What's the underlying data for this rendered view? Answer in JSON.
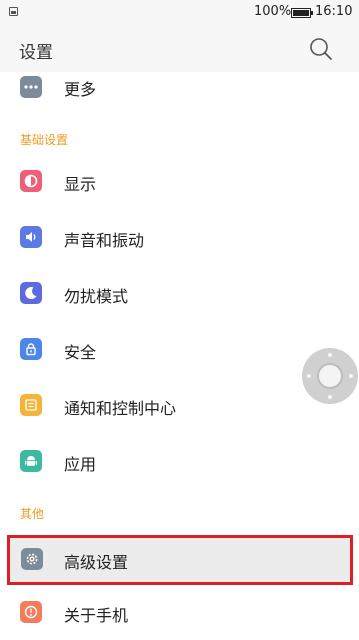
{
  "status_bar": {
    "battery": "100%",
    "time": "16:10"
  },
  "header": {
    "title": "设置"
  },
  "items": {
    "more": "更多",
    "display": "显示",
    "sound": "声音和振动",
    "dnd": "勿扰模式",
    "security": "安全",
    "notifications": "通知和控制中心",
    "apps": "应用",
    "advanced": "高级设置",
    "about": "关于手机"
  },
  "sections": {
    "basic": "基础设置",
    "other": "其他"
  },
  "colors": {
    "accent_orange": "#f19a23",
    "highlight_border": "#e11d26",
    "icon_more": "#7d8a99",
    "icon_display": "#ef5f79",
    "icon_sound": "#5b7be3",
    "icon_dnd": "#5c6be0",
    "icon_security": "#4b86e8",
    "icon_notifications": "#f4b339",
    "icon_apps": "#3cb9a1",
    "icon_advanced": "#7d8a99",
    "icon_about": "#f27c5c"
  },
  "icons": {
    "more": "ellipsis-icon",
    "display": "display-icon",
    "sound": "speaker-icon",
    "dnd": "moon-icon",
    "security": "lock-icon",
    "notifications": "notification-icon",
    "apps": "android-icon",
    "advanced": "gear-icon",
    "about": "info-icon",
    "search": "search-icon"
  }
}
